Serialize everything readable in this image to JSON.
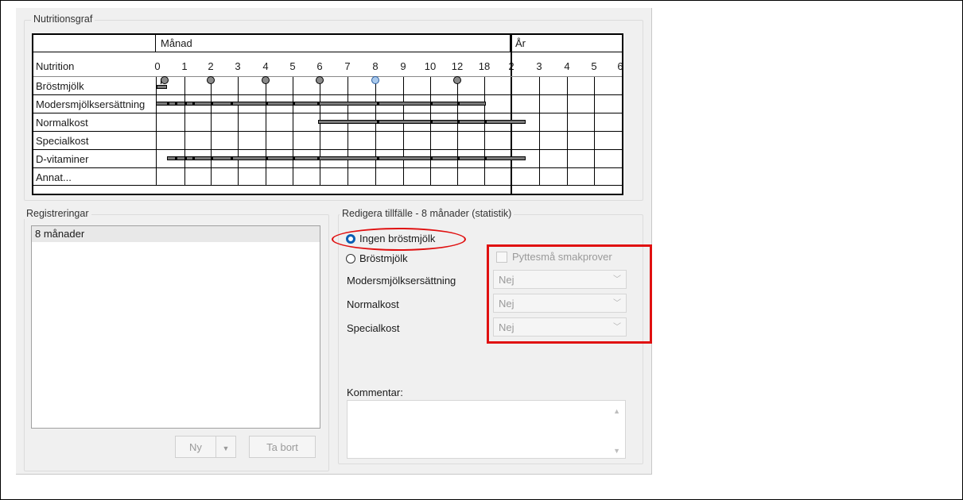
{
  "graph": {
    "group_title": "Nutritionsgraf",
    "header_month": "Månad",
    "header_year": "År",
    "nutrition_label": "Nutrition",
    "month_ticks": [
      "0",
      "1",
      "2",
      "3",
      "4",
      "5",
      "6",
      "7",
      "8",
      "9",
      "10",
      "12",
      "18"
    ],
    "year_ticks": [
      "2",
      "3",
      "4",
      "5",
      "6"
    ],
    "rows": [
      "Bröstmjölk",
      "Modersmjölksersättning",
      "Normalkost",
      "Specialkost",
      "D-vitaminer",
      "Annat..."
    ]
  },
  "registrations": {
    "group_title": "Registreringar",
    "items": [
      "8 månader"
    ],
    "new_button": "Ny",
    "new_dropdown_icon": "triangle-down",
    "delete_button": "Ta bort"
  },
  "edit": {
    "group_title": "Redigera tillfälle - 8 månader (statistik)",
    "radio_no_breastmilk": "Ingen bröstmjölk",
    "radio_breastmilk": "Bröstmjölk",
    "checkbox_tasting": "Pyttesmå smakprover",
    "formula_label": "Modersmjölksersättning",
    "formula_value": "Nej",
    "normal_label": "Normalkost",
    "normal_value": "Nej",
    "special_label": "Specialkost",
    "special_value": "Nej",
    "comment_label": "Kommentar:",
    "comment_value": ""
  },
  "colors": {
    "annotation": "#e01010",
    "radio_selected": "#0a5fb4",
    "bar_fill": "#7a7a7a",
    "selected_dot": "#a9c9ec"
  }
}
